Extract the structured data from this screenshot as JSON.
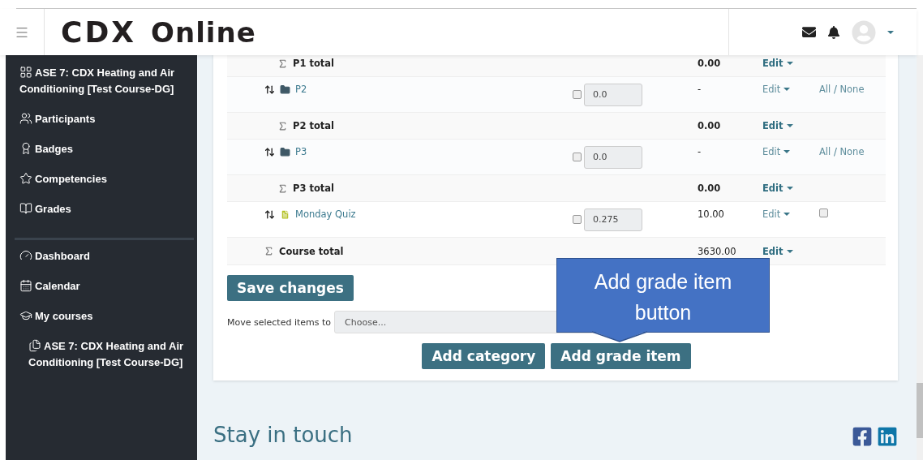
{
  "header": {
    "logo_main": "CDX",
    "logo_rest": "Online"
  },
  "sidebar": {
    "groups": [
      {
        "items": [
          {
            "label": "ASE 7: CDX Heating and Air Conditioning [Test Course-DG]"
          },
          {
            "label": "Participants"
          },
          {
            "label": "Badges"
          },
          {
            "label": "Competencies"
          },
          {
            "label": "Grades"
          }
        ]
      },
      {
        "items": [
          {
            "label": "Dashboard"
          },
          {
            "label": "Calendar"
          },
          {
            "label": "My courses",
            "children": [
              {
                "label": "ASE 7: CDX Heating and Air Conditioning [Test Course-DG]"
              }
            ]
          }
        ]
      }
    ]
  },
  "grade_rows": [
    {
      "kind": "total",
      "name": "P1 total",
      "value": "0.00",
      "edit": "Edit"
    },
    {
      "kind": "category",
      "name": "P2",
      "weight_checked": false,
      "weight": "0.0",
      "value": "-",
      "edit": "Edit",
      "all": "All",
      "separator": "/",
      "none": "None"
    },
    {
      "kind": "total",
      "name": "P2 total",
      "value": "0.00",
      "edit": "Edit"
    },
    {
      "kind": "category",
      "name": "P3",
      "weight_checked": false,
      "weight": "0.0",
      "value": "-",
      "edit": "Edit",
      "all": "All",
      "separator": "/",
      "none": "None"
    },
    {
      "kind": "total",
      "name": "P3 total",
      "value": "0.00",
      "edit": "Edit"
    },
    {
      "kind": "item",
      "name": "Monday Quiz",
      "weight_checked": false,
      "weight": "0.275",
      "value": "10.00",
      "edit": "Edit",
      "select_checked": false
    },
    {
      "kind": "course_total",
      "name": "Course total",
      "value": "3630.00",
      "edit": "Edit"
    }
  ],
  "save_button": "Save changes",
  "move": {
    "label": "Move selected items to",
    "placeholder": "Choose..."
  },
  "actions": [
    "Add category",
    "Add grade item"
  ],
  "callout": {
    "text": "Add grade item button"
  },
  "footer": {
    "heading": "Stay in touch"
  }
}
